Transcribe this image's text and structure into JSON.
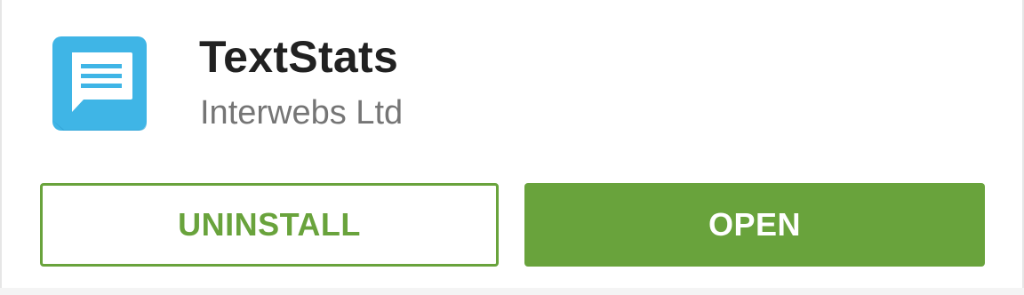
{
  "app": {
    "title": "TextStats",
    "developer": "Interwebs Ltd",
    "icon": "chat-bubble-lines-icon"
  },
  "actions": {
    "uninstall_label": "UNINSTALL",
    "open_label": "OPEN"
  },
  "colors": {
    "accent": "#69a33c",
    "icon_background": "#3fb5e6",
    "title_text": "#212121",
    "developer_text": "#757575"
  }
}
